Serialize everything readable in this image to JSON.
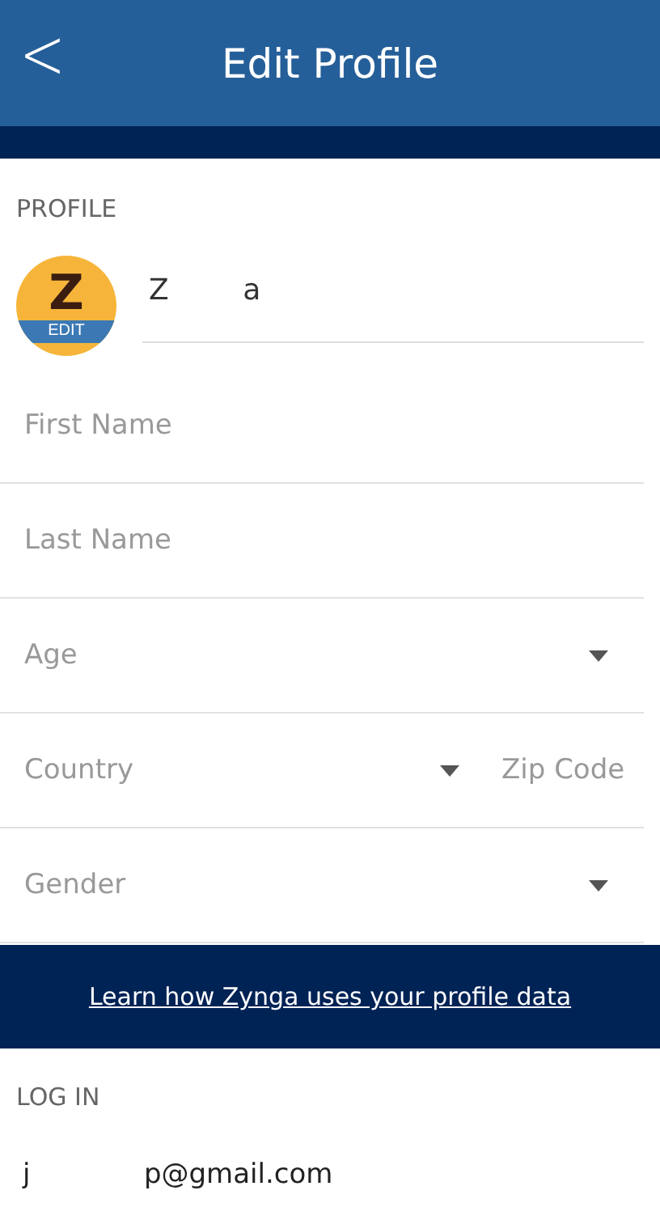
{
  "header": {
    "back": "<",
    "title": "Edit Profile"
  },
  "profile": {
    "heading": "PROFILE",
    "avatar_letter": "Z",
    "avatar_edit": "EDIT",
    "name": "Z        a"
  },
  "fields": [
    {
      "kind": "text",
      "placeholder": "First Name"
    },
    {
      "kind": "text",
      "placeholder": "Last Name"
    },
    {
      "kind": "select",
      "placeholder": "Age"
    },
    {
      "kind": "select_zip",
      "placeholder": "Country",
      "zip_placeholder": "Zip Code"
    },
    {
      "kind": "select",
      "placeholder": "Gender"
    }
  ],
  "banner": {
    "link": "Learn how Zynga uses your profile data"
  },
  "login": {
    "heading": "LOG IN",
    "email": "j             p@gmail.com"
  }
}
